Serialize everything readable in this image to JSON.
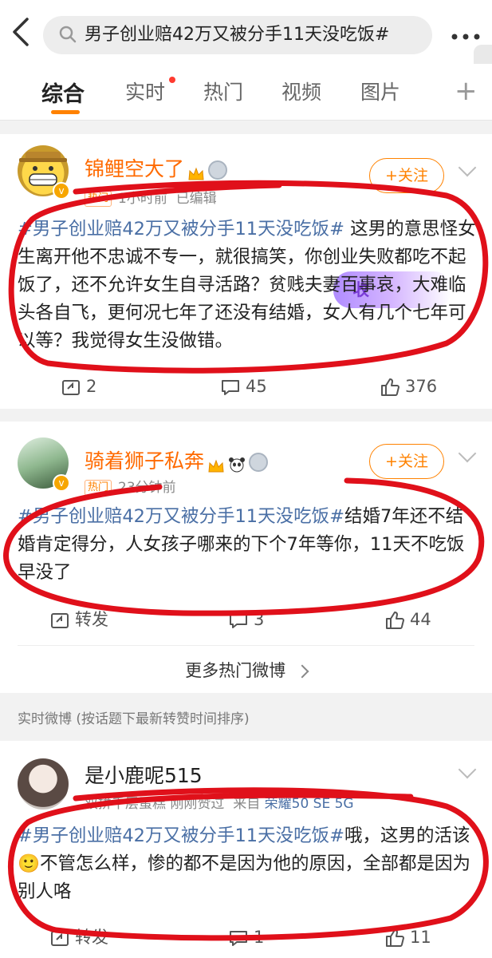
{
  "header": {
    "back_icon": "back-arrow-icon",
    "search_text": "男子创业赔42万又被分手11天没吃饭#",
    "more_icon": "more-dots-icon"
  },
  "tabs": [
    {
      "label": "综合",
      "active": true
    },
    {
      "label": "实时",
      "dot": true
    },
    {
      "label": "热门"
    },
    {
      "label": "视频"
    },
    {
      "label": "图片"
    }
  ],
  "posts": [
    {
      "username": "锦鲤空大了",
      "badge": "热门",
      "time": "1小时前",
      "edited": "已编辑",
      "follow_label": "+关注",
      "decor_text": "收",
      "tag": "#男子创业赔42万又被分手11天没吃饭#",
      "body": " 这男的意思怪女生离开他不忠诚不专一，就很搞笑，你创业失败都吃不起饭了，还不允许女生自寻活路？贫贱夫妻百事哀，大难临头各自飞，更何况七年了还没有结婚，女人有几个七年可以等？我觉得女生没做错。",
      "reposts": "2",
      "comments": "45",
      "likes": "376"
    },
    {
      "username": "骑着狮子私奔",
      "badge": "热门",
      "time": "23分钟前",
      "follow_label": "+关注",
      "tag": "#男子创业赔42万又被分手11天没吃饭#",
      "body": "结婚7年还不结婚肯定得分，人女孩子哪来的下个7年等你，11天不吃饭早没了",
      "reposts": "转发",
      "comments": "3",
      "likes": "44"
    }
  ],
  "more_hot": "更多热门微博",
  "realtime_label": "实时微博 (按话题下最新转赞时间排序)",
  "realtime_post": {
    "username": "是小鹿呢515",
    "meta_prefix": "双拼千层蛋糕 刚刚赞过",
    "source_prefix": "来自",
    "source_device": "荣耀50 SE 5G",
    "tag": "#男子创业赔42万又被分手11天没吃饭#",
    "body_a": "哦，这男的活该",
    "emoji": "🙂",
    "body_b": "不管怎么样，惨的都不是因为他的原因，全部都是因为别人咯",
    "reposts": "转发",
    "comments": "1",
    "likes": "11"
  },
  "colors": {
    "accent_orange": "#ff8200",
    "topic_blue": "#4a6fa5",
    "annotation_red": "#e0101a"
  }
}
